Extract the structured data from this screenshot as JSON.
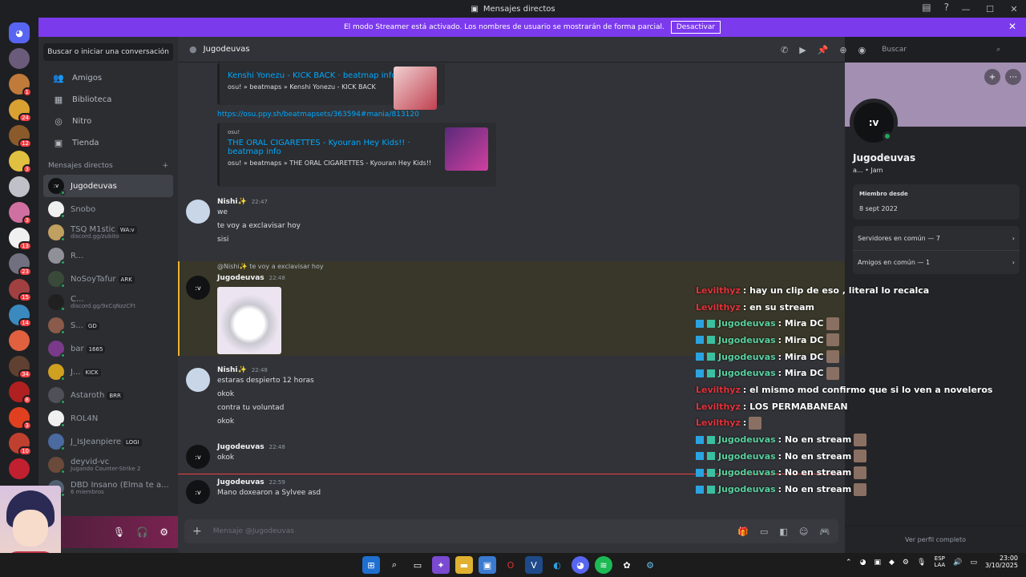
{
  "window": {
    "title": "Mensajes directos"
  },
  "streamer_banner": {
    "text": "El modo Streamer está activado. Los nombres de usuario se mostrarán de forma parcial.",
    "button": "Desactivar"
  },
  "servers": [
    {
      "color": "#6b5b7a",
      "badge": ""
    },
    {
      "color": "#c07a3a",
      "badge": "1"
    },
    {
      "color": "#d9a032",
      "badge": "24"
    },
    {
      "color": "#8a5a2a",
      "badge": "12"
    },
    {
      "color": "#e0c040",
      "badge": "3"
    },
    {
      "color": "#c0c0c8",
      "badge": ""
    },
    {
      "color": "#d070a0",
      "badge": "3"
    },
    {
      "color": "#f0f0f0",
      "badge": "13"
    },
    {
      "color": "#707080",
      "badge": "23"
    },
    {
      "color": "#a04040",
      "badge": "15"
    },
    {
      "color": "#3a8ac0",
      "badge": "14"
    },
    {
      "color": "#e06040",
      "badge": ""
    },
    {
      "color": "#604030",
      "badge": "34"
    },
    {
      "color": "#b02020",
      "badge": "8"
    },
    {
      "color": "#e04020",
      "badge": "3"
    },
    {
      "color": "#c04030",
      "badge": "10"
    },
    {
      "color": "#c02030",
      "badge": ""
    }
  ],
  "sidebar": {
    "search": "Buscar o iniciar una conversación",
    "nav": [
      {
        "icon": "👥",
        "label": "Amigos",
        "name": "friends"
      },
      {
        "icon": "▦",
        "label": "Biblioteca",
        "name": "library"
      },
      {
        "icon": "◎",
        "label": "Nitro",
        "name": "nitro"
      },
      {
        "icon": "▣",
        "label": "Tienda",
        "name": "shop"
      }
    ],
    "dm_header": "Mensajes directos",
    "dms": [
      {
        "name": "Jugodeuvas",
        "sub": "",
        "tag": "",
        "color": "#111214",
        "text": ":v",
        "active": true
      },
      {
        "name": "Snobo",
        "sub": "",
        "tag": "",
        "color": "#f0f0f0",
        "text": ""
      },
      {
        "name": "TSQ M1stic",
        "sub": "discord.gg/zubito",
        "tag": "WA:v",
        "color": "#c0a060",
        "text": ""
      },
      {
        "name": "R...",
        "sub": "",
        "tag": "",
        "color": "#909098",
        "text": ""
      },
      {
        "name": "NoSoyTafur",
        "sub": "",
        "tag": "ARK",
        "color": "#3a4a3a",
        "text": ""
      },
      {
        "name": "C...",
        "sub": "discord.gg/9xCqNzzCFt",
        "tag": "",
        "color": "#202020",
        "text": ""
      },
      {
        "name": "S...",
        "sub": "",
        "tag": "GD",
        "color": "#8a5a4a",
        "text": ""
      },
      {
        "name": "bar",
        "sub": "",
        "tag": "1665",
        "color": "#7a3a8a",
        "text": ""
      },
      {
        "name": "J...",
        "sub": "",
        "tag": "KICK",
        "color": "#d0a020",
        "text": ""
      },
      {
        "name": "Astaroth",
        "sub": "",
        "tag": "BRR",
        "color": "#505058",
        "text": ""
      },
      {
        "name": "ROL4N",
        "sub": "",
        "tag": "",
        "color": "#f0f0f0",
        "text": ""
      },
      {
        "name": "J_IsJeanpiere",
        "sub": "",
        "tag": "LOGI",
        "color": "#4a6aa0",
        "text": ""
      },
      {
        "name": "deyvid-vc",
        "sub": "Jugando Counter-Strike 2",
        "tag": "",
        "color": "#6a4a3a",
        "text": ""
      },
      {
        "name": "DBD Insano (Elma te a...",
        "sub": "6 miembros",
        "tag": "",
        "color": "#506070",
        "text": ""
      }
    ]
  },
  "chat": {
    "channel": "Jugodeuvas",
    "search_placeholder": "Buscar",
    "embed1": {
      "title": "Kenshi Yonezu - KICK BACK · beatmap info",
      "desc": "osu! » beatmaps » Kenshi Yonezu - KICK BACK"
    },
    "link": "https://osu.ppy.sh/beatmapsets/363594#mania/813120",
    "embed2": {
      "provider": "osu!",
      "title": "THE ORAL CIGARETTES - Kyouran Hey Kids!! · beatmap info",
      "desc": "osu! » beatmaps » THE ORAL CIGARETTES - Kyouran Hey Kids!!"
    },
    "msg1": {
      "author": "Nishi✨",
      "time": "22:47",
      "lines": [
        "we",
        "te voy a exclavisar hoy",
        "sisi"
      ]
    },
    "reply": {
      "to": "@Nishi✨",
      "text": "te voy a exclavisar hoy"
    },
    "msg2": {
      "author": "Jugodeuvas",
      "time": "22:48"
    },
    "msg3": {
      "author": "Nishi✨",
      "time": "22:48",
      "lines": [
        "estaras despierto 12 horas",
        "okok",
        "contra tu voluntad",
        "okok"
      ]
    },
    "msg4": {
      "author": "Jugodeuvas",
      "time": "22:48",
      "lines": [
        "okok"
      ]
    },
    "msg5": {
      "author": "Jugodeuvas",
      "time": "22:59",
      "lines": [
        "Mano doxearon a Sylvee asd"
      ]
    },
    "composer_placeholder": "Mensaje @Jugodeuvas"
  },
  "overlay": [
    {
      "user": "Levilthyz",
      "kind": "u1",
      "text": ": hay un clip de eso , literal lo recalca",
      "emote": false
    },
    {
      "user": "Levilthyz",
      "kind": "u1",
      "text": ": en su stream",
      "emote": false
    },
    {
      "user": "Jugodeuvas",
      "kind": "u2",
      "text": ": Mira DC",
      "emote": true
    },
    {
      "user": "Jugodeuvas",
      "kind": "u2",
      "text": ": Mira DC",
      "emote": true
    },
    {
      "user": "Jugodeuvas",
      "kind": "u2",
      "text": ": Mira DC",
      "emote": true
    },
    {
      "user": "Jugodeuvas",
      "kind": "u2",
      "text": ": Mira DC",
      "emote": true
    },
    {
      "user": "Levilthyz",
      "kind": "u1",
      "text": ": el mismo mod confirmo que si lo ven a noveleros",
      "emote": false
    },
    {
      "user": "Levilthyz",
      "kind": "u1",
      "text": ": LOS PERMABANEAN",
      "emote": false
    },
    {
      "user": "Levilthyz",
      "kind": "u1",
      "text": ":",
      "emote": true
    },
    {
      "user": "Jugodeuvas",
      "kind": "u2",
      "text": ": No en stream",
      "emote": true
    },
    {
      "user": "Jugodeuvas",
      "kind": "u2",
      "text": ": No en stream",
      "emote": true
    },
    {
      "user": "Jugodeuvas",
      "kind": "u2",
      "text": ": No en stream",
      "emote": true
    },
    {
      "user": "Jugodeuvas",
      "kind": "u2",
      "text": ": No en stream",
      "emote": true
    }
  ],
  "profile": {
    "avatar_text": ":v",
    "name": "Jugodeuvas",
    "sub": "a... • Jam",
    "member_since_label": "Miembro desde",
    "member_since": "8 sept 2022",
    "servers_common": "Servidores en común — 7",
    "friends_common": "Amigos en común — 1",
    "view_full": "Ver perfil completo"
  },
  "taskbar": {
    "lang1": "ESP",
    "lang2": "LAA",
    "time": "23:00",
    "date": "3/10/2025"
  }
}
